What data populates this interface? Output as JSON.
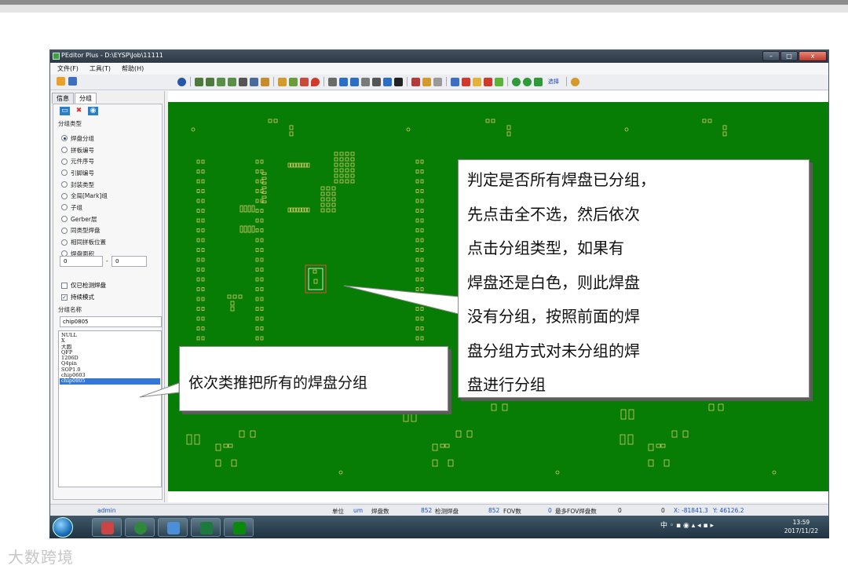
{
  "window": {
    "title": "PEditor Plus - D:\\EYSP\\Job\\11111",
    "buttons": [
      "–",
      "□",
      "x"
    ]
  },
  "menu": {
    "items": [
      "文件(F)",
      "工具(T)",
      "帮助(H)"
    ]
  },
  "toolbar": {
    "select_label": "选择"
  },
  "left_panel": {
    "tabs": [
      "信息",
      "分组"
    ],
    "group_type_label": "分组类型",
    "group_types": [
      "焊盘分组",
      "拼板编号",
      "元件序号",
      "引脚编号",
      "封装类型",
      "全局[Mark]组",
      "子组",
      "Gerber层",
      "同类型焊盘",
      "相同拼板位置",
      "焊盘面积"
    ],
    "selected_group_type": "焊盘分组",
    "area_min": "0",
    "area_max": "0",
    "range_dash": "-",
    "only_detected_label": "仅已检测焊盘",
    "only_detected_checked": false,
    "continuous_mode_label": "持续模式",
    "continuous_mode_checked": true,
    "group_name_label": "分组名称",
    "group_name_value": "chip0805",
    "group_list": [
      "NULL",
      "X",
      "大圆",
      "QFP",
      "1206D",
      "Q4pin",
      "SOP1.0",
      "chip0603",
      "chip0805"
    ],
    "selected_group": "chip0805"
  },
  "status": {
    "user": "admin",
    "unit_label": "单位",
    "unit_value": "um",
    "pad_count_label": "焊盘数",
    "pad_count": "852",
    "checked_pads_label": "检测焊盘",
    "checked_pads": "852",
    "fov_label": "FOV数",
    "fov_count": "0",
    "max_fov_label": "最多FOV焊盘数",
    "max_fov_count": "0",
    "extra_value": "0",
    "coord_x": "X: -81841.3",
    "coord_y": "Y: 46126.2"
  },
  "taskbar": {
    "tray_text": "中",
    "time": "13:59",
    "date": "2017/11/22"
  },
  "callouts": {
    "left": "依次类推把所有的焊盘分组",
    "right": [
      "判定是否所有焊盘已分组，",
      "先点击全不选，然后依次",
      "点击分组类型，如果有",
      "焊盘还是白色，则此焊盘",
      "没有分组，按照前面的焊",
      "盘分组方式对未分组的焊",
      "盘进行分组"
    ]
  },
  "watermark": "大数跨境",
  "colors": {
    "board_green": "#087d06",
    "pad_outline": "#d7c868",
    "selection_blue": "#3578d4",
    "link_blue": "#1b4fc7"
  }
}
